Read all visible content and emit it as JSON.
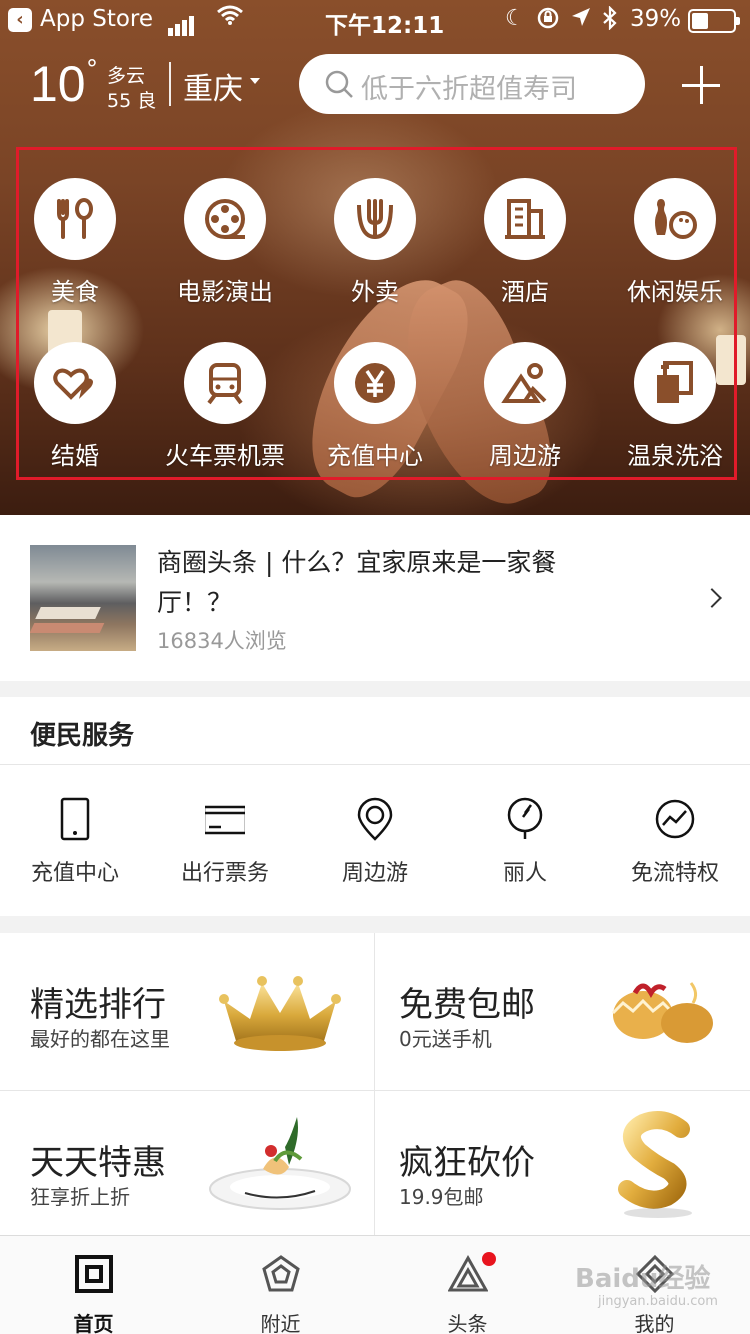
{
  "status_bar": {
    "back_app": "App Store",
    "time": "下午12:11",
    "battery": "39%",
    "battery_level": 0.39
  },
  "header": {
    "temperature": "10",
    "degree": "°",
    "weather": "多云",
    "aqi": "55 良",
    "city": "重庆",
    "search_placeholder": "低于六折超值寿司"
  },
  "categories": [
    {
      "label": "美食",
      "icon": "fork-spoon-icon"
    },
    {
      "label": "电影演出",
      "icon": "film-reel-icon"
    },
    {
      "label": "外卖",
      "icon": "takeout-fork-icon"
    },
    {
      "label": "酒店",
      "icon": "hotel-building-icon"
    },
    {
      "label": "休闲娱乐",
      "icon": "bowling-icon"
    },
    {
      "label": "结婚",
      "icon": "hearts-icon"
    },
    {
      "label": "火车票机票",
      "icon": "train-icon"
    },
    {
      "label": "充值中心",
      "icon": "yen-coin-icon"
    },
    {
      "label": "周边游",
      "icon": "mountain-sun-icon"
    },
    {
      "label": "温泉洗浴",
      "icon": "bath-towel-icon"
    }
  ],
  "headline": {
    "title": "商圈头条 | 什么？宜家原来是一家餐厅！？",
    "views": "16834人浏览"
  },
  "services": {
    "title": "便民服务",
    "items": [
      {
        "label": "充值中心",
        "icon": "phone-icon"
      },
      {
        "label": "出行票务",
        "icon": "ticket-card-icon"
      },
      {
        "label": "周边游",
        "icon": "location-pin-icon"
      },
      {
        "label": "丽人",
        "icon": "mirror-icon"
      },
      {
        "label": "免流特权",
        "icon": "data-pulse-icon"
      }
    ]
  },
  "promos": [
    {
      "title": "精选排行",
      "subtitle": "最好的都在这里",
      "art": "crown-image"
    },
    {
      "title": "免费包邮",
      "subtitle": "0元送手机",
      "art": "golden-egg-image"
    },
    {
      "title": "天天特惠",
      "subtitle": "狂享折上折",
      "art": "dessert-plate-image"
    },
    {
      "title": "疯狂砍价",
      "subtitle": "19.9包邮",
      "art": "gold-dollar-image"
    }
  ],
  "tabbar": [
    {
      "label": "首页",
      "icon": "home-square-icon",
      "active": true
    },
    {
      "label": "附近",
      "icon": "pentagon-icon",
      "active": false
    },
    {
      "label": "头条",
      "icon": "triangle-icon",
      "active": false,
      "badge": true
    },
    {
      "label": "我的",
      "icon": "diamond-icon",
      "active": false
    }
  ],
  "watermark": {
    "brand": "Baidu经验",
    "url": "jingyan.baidu.com"
  },
  "colors": {
    "accent": "#8a4f2b",
    "highlight_box": "#e01b2a",
    "badge": "#e8141e"
  }
}
